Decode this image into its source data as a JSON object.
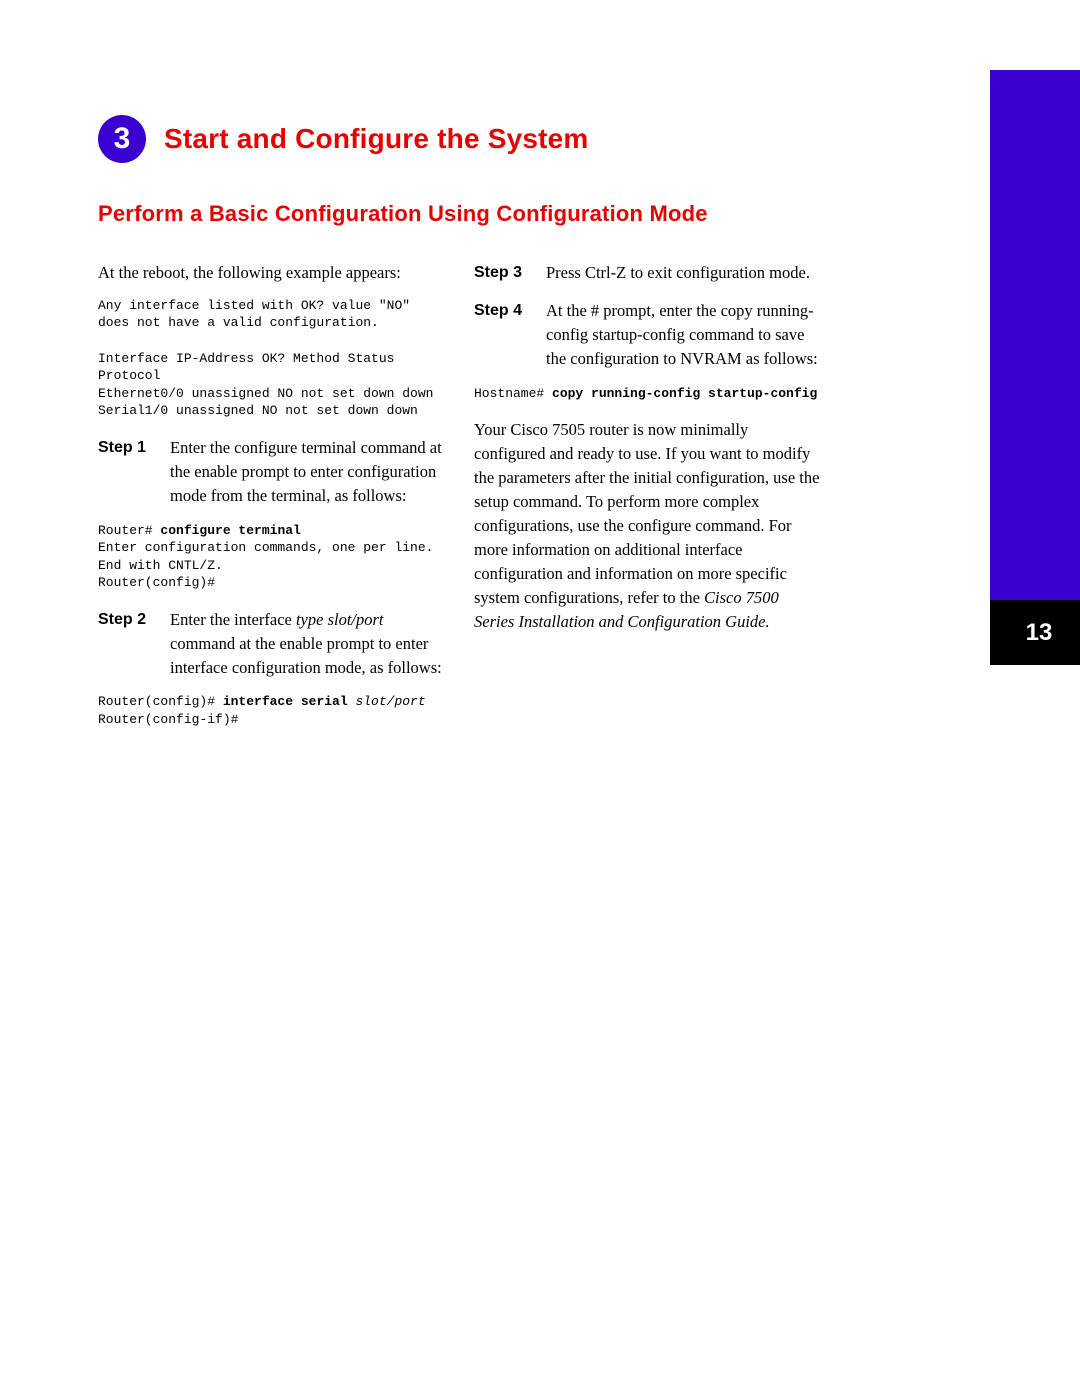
{
  "chapter": {
    "number": "3",
    "title": "Start and Configure the System"
  },
  "section_title": "Perform a Basic Configuration Using Configuration Mode",
  "page_number": "13",
  "left": {
    "intro": "At the reboot, the following example appears:",
    "code1": "Any interface listed with OK? value \"NO\" does not have a valid configuration.\n\nInterface IP-Address OK? Method Status Protocol\nEthernet0/0 unassigned NO not set down down\nSerial1/0 unassigned NO not set down down",
    "step1_label": "Step 1",
    "step1_body": "Enter the configure terminal command at the enable prompt to enter configuration mode from the terminal, as follows:",
    "code2_prefix": "Router# ",
    "code2_bold": "configure terminal",
    "code2_rest": "\nEnter configuration commands, one per line. End with CNTL/Z.\nRouter(config)#",
    "step2_label": "Step 2",
    "step2_pre": "Enter the interface ",
    "step2_ital": "type slot/port",
    "step2_post": " command at the enable prompt to enter interface configuration mode, as follows:",
    "code3_prefix": "Router(config)# ",
    "code3_bold": "interface serial ",
    "code3_ital": "slot/port",
    "code3_rest": "\nRouter(config-if)#"
  },
  "right": {
    "step3_label": "Step 3",
    "step3_body": "Press Ctrl-Z to exit configuration mode.",
    "step4_label": "Step 4",
    "step4_body": "At the # prompt, enter the copy running-config startup-config command to save the configuration to NVRAM as follows:",
    "code4_prefix": "Hostname# ",
    "code4_bold": "copy running-config startup-config",
    "closing_pre": "Your Cisco 7505 router is now minimally configured and ready to use. If you want to modify the parameters after the initial configuration, use the setup command. To perform more complex configurations, use the configure command. For more information on additional interface configuration and information on more specific system configurations, refer to the ",
    "closing_ital": "Cisco 7500 Series Installation and Configuration Guide.",
    "closing_post": ""
  }
}
